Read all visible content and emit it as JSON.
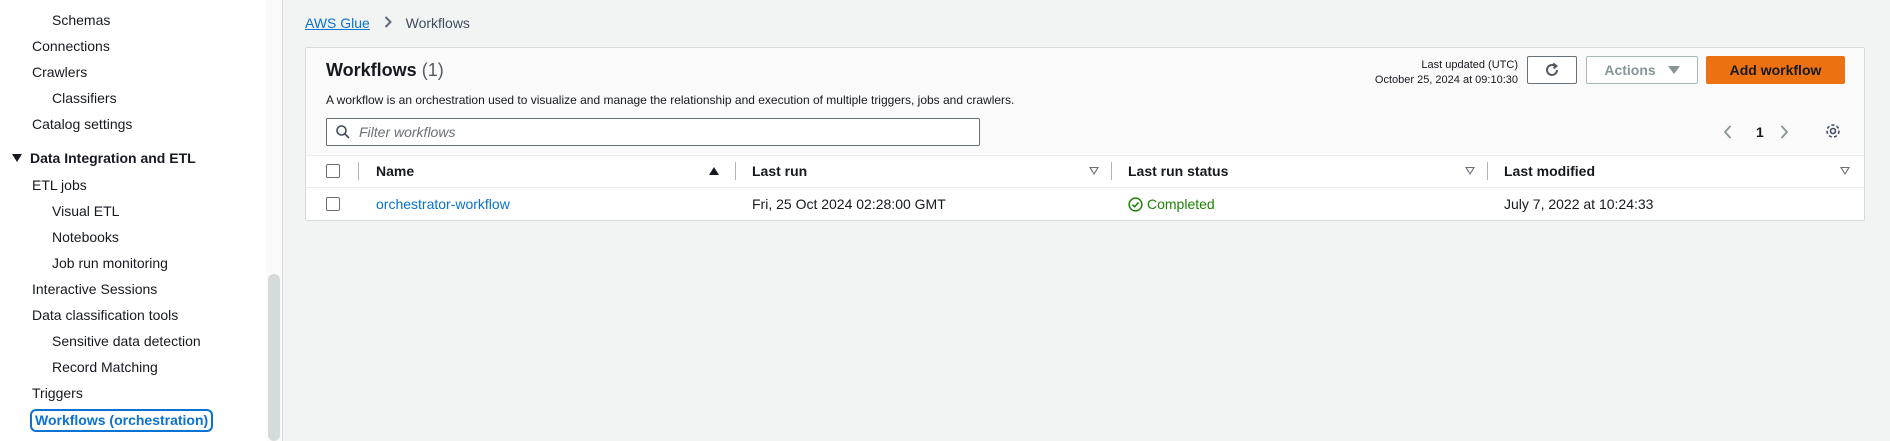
{
  "sidebar": {
    "items": [
      {
        "label": "Schemas",
        "level": 2
      },
      {
        "label": "Connections",
        "level": 1
      },
      {
        "label": "Crawlers",
        "level": 1
      },
      {
        "label": "Classifiers",
        "level": 2
      },
      {
        "label": "Catalog settings",
        "level": 1
      }
    ],
    "section": "Data Integration and ETL",
    "section_items": [
      {
        "label": "ETL jobs",
        "level": 1
      },
      {
        "label": "Visual ETL",
        "level": 2
      },
      {
        "label": "Notebooks",
        "level": 2
      },
      {
        "label": "Job run monitoring",
        "level": 2
      },
      {
        "label": "Interactive Sessions",
        "level": 1
      },
      {
        "label": "Data classification tools",
        "level": 1
      },
      {
        "label": "Sensitive data detection",
        "level": 2
      },
      {
        "label": "Record Matching",
        "level": 2
      },
      {
        "label": "Triggers",
        "level": 1
      }
    ],
    "active": "Workflows (orchestration)"
  },
  "breadcrumb": {
    "root": "AWS Glue",
    "current": "Workflows"
  },
  "panel": {
    "title": "Workflows",
    "count": "(1)",
    "description": "A workflow is an orchestration used to visualize and manage the relationship and execution of multiple triggers, jobs and crawlers.",
    "last_updated_label": "Last updated (UTC)",
    "last_updated_value": "October 25, 2024 at 09:10:30",
    "actions_label": "Actions",
    "add_label": "Add workflow",
    "filter_placeholder": "Filter workflows",
    "page": "1"
  },
  "table": {
    "columns": [
      "Name",
      "Last run",
      "Last run status",
      "Last modified"
    ],
    "rows": [
      {
        "name": "orchestrator-workflow",
        "last_run": "Fri, 25 Oct 2024 02:28:00 GMT",
        "status": "Completed",
        "last_modified": "July 7, 2022 at 10:24:33"
      }
    ]
  },
  "colors": {
    "accent": "#0972d3",
    "primary_button": "#ec7211",
    "success": "#1d8102"
  }
}
